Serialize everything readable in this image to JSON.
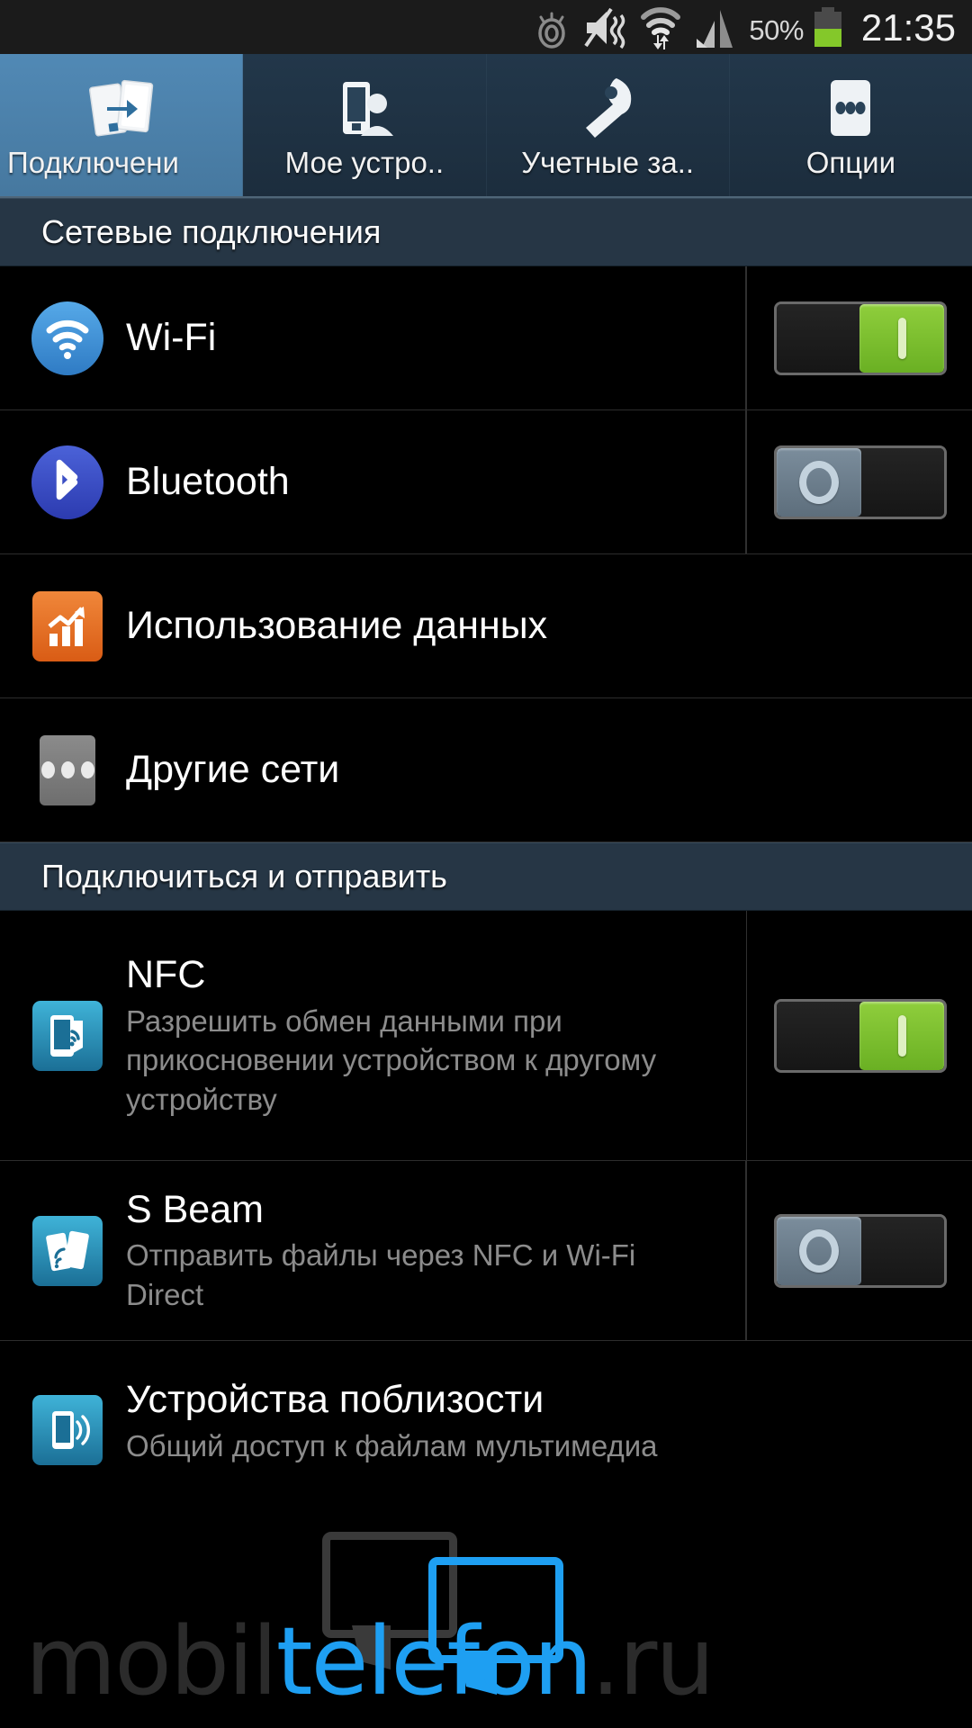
{
  "statusbar": {
    "icons": [
      "smart-stay-eye-icon",
      "mute-vibrate-icon",
      "wifi-transfer-icon",
      "signal-bars-icon"
    ],
    "battery_percent": "50%",
    "battery_icon": "battery-icon",
    "clock": "21:35"
  },
  "tabs": [
    {
      "label": "Подключени",
      "icon": "connections-icon",
      "active": true
    },
    {
      "label": "Мое устро..",
      "icon": "my-device-icon",
      "active": false
    },
    {
      "label": "Учетные за..",
      "icon": "accounts-key-icon",
      "active": false
    },
    {
      "label": "Опции",
      "icon": "more-options-icon",
      "active": false
    }
  ],
  "sections": [
    {
      "header": "Сетевые подключения",
      "rows": [
        {
          "title": "Wi-Fi",
          "sub": "",
          "icon": "wifi-icon",
          "toggle": "on"
        },
        {
          "title": "Bluetooth",
          "sub": "",
          "icon": "bluetooth-icon",
          "toggle": "off"
        },
        {
          "title": "Использование данных",
          "sub": "",
          "icon": "data-usage-icon",
          "toggle": "none"
        },
        {
          "title": "Другие сети",
          "sub": "",
          "icon": "more-networks-icon",
          "toggle": "none"
        }
      ]
    },
    {
      "header": "Подключиться и отправить",
      "rows": [
        {
          "title": "NFC",
          "sub": "Разрешить обмен данными при прикосновении устройством к другому устройству",
          "icon": "nfc-icon",
          "toggle": "on"
        },
        {
          "title": "S Beam",
          "sub": "Отправить файлы через NFC и Wi-Fi Direct",
          "icon": "s-beam-icon",
          "toggle": "off"
        },
        {
          "title": "Устройства поблизости",
          "sub": "Общий доступ к файлам мультимедиа",
          "icon": "nearby-devices-icon",
          "toggle": "none"
        }
      ]
    }
  ],
  "watermark": {
    "part1": "mobil",
    "part2": "telefon",
    "part3": ".ru"
  },
  "colors": {
    "accent_blue": "#5189b5",
    "toggle_on": "#7cc230",
    "toggle_off": "#6d7e8c",
    "header_bg": "#263645",
    "orange": "#e06b1d",
    "cyan": "#2b8fb8"
  }
}
